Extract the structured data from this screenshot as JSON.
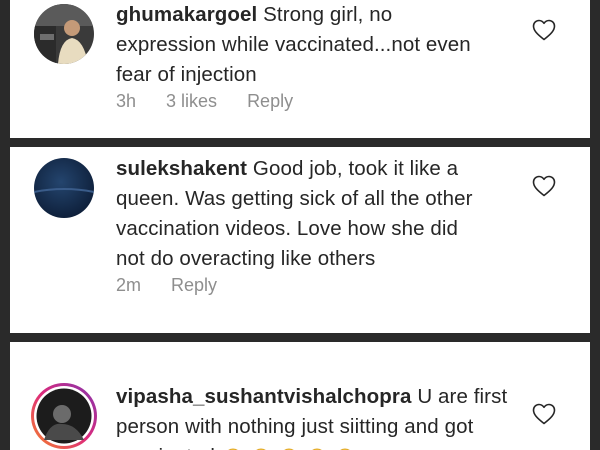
{
  "comments": [
    {
      "username": "ghumakargoel",
      "text": "Strong girl, no expression while vaccinated...not even fear of injection",
      "line1": "Strong girl, no",
      "line2": "expression while vaccinated...not even",
      "line3": "fear of injection",
      "time": "3h",
      "likes": "3 likes",
      "reply": "Reply",
      "avatar_icon": "profile-photo-car",
      "heart_icon": "heart-outline-icon"
    },
    {
      "username": "sulekshakent",
      "text": "Good job, took it like a queen. Was getting sick of all the other vaccination videos. Love how she did not do overacting like others",
      "line1": "Good job, took it like a",
      "line2": "queen. Was getting sick of all the other",
      "line3": "vaccination videos. Love how she did",
      "line4": "not do overacting like others",
      "time": "2m",
      "reply": "Reply",
      "avatar_icon": "profile-photo-dark-blue",
      "heart_icon": "heart-outline-icon"
    },
    {
      "username": "vipasha_sushantvishalchopra",
      "text": "U are first person with nothing just siitting and got vaccinated",
      "line1": "U are first",
      "line2": "person with nothing just siitting and got",
      "line3": "vaccinated",
      "avatar_icon": "profile-photo-story-ring",
      "heart_icon": "heart-outline-icon",
      "emoji": "clapping-hands"
    }
  ],
  "colors": {
    "text": "#262626",
    "meta": "#8e8e8e",
    "separator": "#2a2a2a",
    "story_ring_start": "#f58529",
    "story_ring_end": "#dd2a7b"
  }
}
